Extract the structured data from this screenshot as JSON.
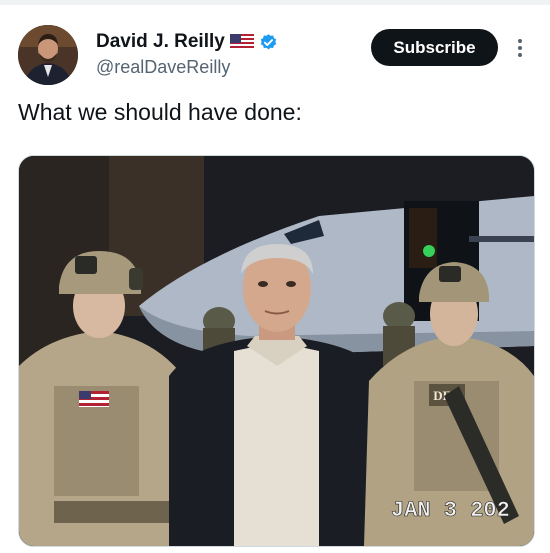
{
  "author": {
    "name": "David J. Reilly",
    "handle": "@realDaveReilly",
    "flag_icon": "us-flag-icon",
    "verified_icon": "verified-badge-icon",
    "verified_color": "#1d9bf0"
  },
  "actions": {
    "subscribe_label": "Subscribe",
    "more_icon": "more-vertical-icon"
  },
  "tweet": {
    "text": "What we should have done:"
  },
  "media": {
    "timestamp_overlay": "JAN 3 202",
    "vest_patch_text": "DEA"
  },
  "colors": {
    "text_primary": "#0f1419",
    "text_secondary": "#536471",
    "button_bg": "#0f1419",
    "button_text": "#ffffff"
  }
}
